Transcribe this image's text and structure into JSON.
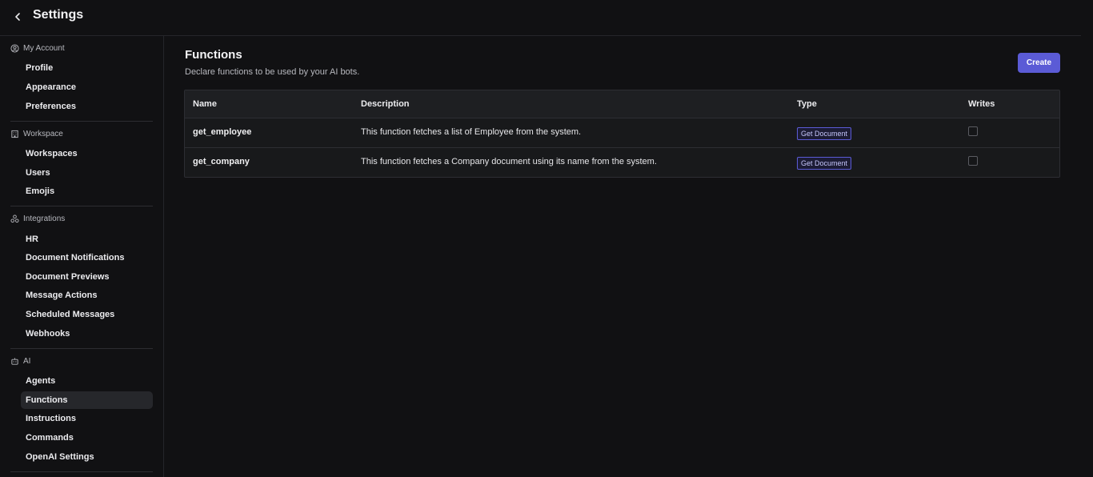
{
  "header": {
    "title": "Settings"
  },
  "sidebar": {
    "groups": [
      {
        "label": "My Account",
        "icon": "user-circle-icon",
        "items": [
          "Profile",
          "Appearance",
          "Preferences"
        ]
      },
      {
        "label": "Workspace",
        "icon": "building-icon",
        "items": [
          "Workspaces",
          "Users",
          "Emojis"
        ]
      },
      {
        "label": "Integrations",
        "icon": "integrations-icon",
        "items": [
          "HR",
          "Document Notifications",
          "Document Previews",
          "Message Actions",
          "Scheduled Messages",
          "Webhooks"
        ]
      },
      {
        "label": "AI",
        "icon": "robot-icon",
        "items": [
          "Agents",
          "Functions",
          "Instructions",
          "Commands",
          "OpenAI Settings"
        ]
      }
    ],
    "active_item": "Functions"
  },
  "main": {
    "title": "Functions",
    "description": "Declare functions to be used by your AI bots.",
    "create_label": "Create",
    "table": {
      "columns": [
        "Name",
        "Description",
        "Type",
        "Writes"
      ],
      "rows": [
        {
          "name": "get_employee",
          "description": "This function fetches a list of Employee from the system.",
          "type": "Get Document",
          "writes": false
        },
        {
          "name": "get_company",
          "description": "This function fetches a Company document using its name from the system.",
          "type": "Get Document",
          "writes": false
        }
      ]
    }
  },
  "colors": {
    "accent": "#5b5bd6",
    "background": "#111113",
    "active_item_bg": "#26272b"
  }
}
